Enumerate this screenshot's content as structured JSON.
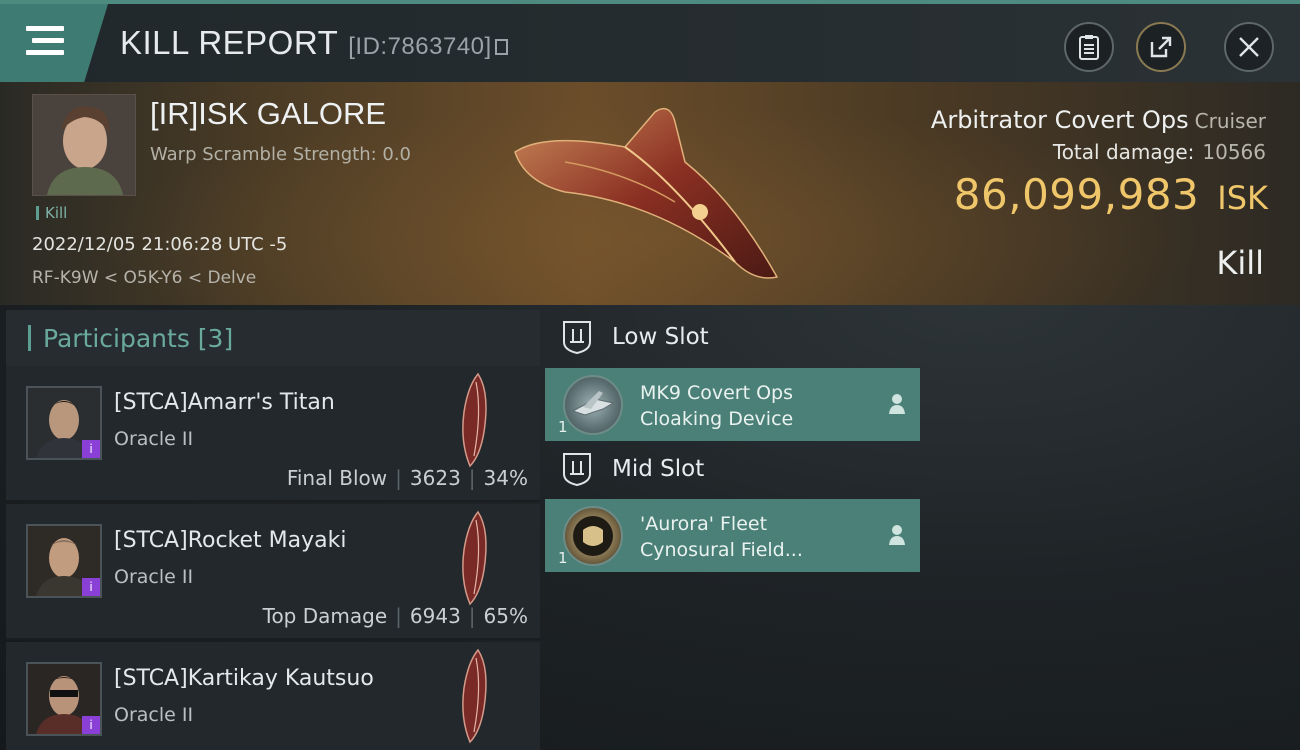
{
  "header": {
    "title": "KILL REPORT",
    "report_id": "[ID:7863740]"
  },
  "victim": {
    "name": "[IR]ISK GALORE",
    "warp_scramble": "Warp Scramble Strength: 0.0",
    "kill_tag": "Kill",
    "datetime": "2022/12/05 21:06:28 UTC -5",
    "location": "RF-K9W < O5K-Y6 < Delve"
  },
  "ship": {
    "name": "Arbitrator Covert Ops",
    "class": "Cruiser",
    "total_damage_label": "Total damage:",
    "total_damage": "10566",
    "isk_value": "86,099,983",
    "isk_unit": "ISK",
    "result_label": "Kill"
  },
  "participants": {
    "title": "Participants [3]",
    "items": [
      {
        "name": "[STCA]Amarr's Titan",
        "ship": "Oracle II",
        "label": "Final Blow",
        "damage": "3623",
        "percent": "34%"
      },
      {
        "name": "[STCA]Rocket Mayaki",
        "ship": "Oracle II",
        "label": "Top Damage",
        "damage": "6943",
        "percent": "65%"
      },
      {
        "name": "[STCA]Kartikay Kautsuo",
        "ship": "Oracle II",
        "label": "",
        "damage": "",
        "percent": ""
      }
    ]
  },
  "slots": {
    "low": {
      "title": "Low Slot",
      "module": {
        "qty": "1",
        "line1": "MK9 Covert Ops",
        "line2": "Cloaking Device"
      }
    },
    "mid": {
      "title": "Mid Slot",
      "module": {
        "qty": "1",
        "line1": "'Aurora' Fleet",
        "line2": "Cynosural Field..."
      }
    }
  },
  "colors": {
    "accent_teal": "#4a8077",
    "isk_gold": "#f0c66a",
    "corp_badge": "#8a3fd6"
  },
  "icons": [
    "menu-icon",
    "copy-id-icon",
    "clipboard-icon",
    "export-icon",
    "close-icon",
    "slot-low-icon",
    "slot-mid-icon",
    "person-icon"
  ]
}
